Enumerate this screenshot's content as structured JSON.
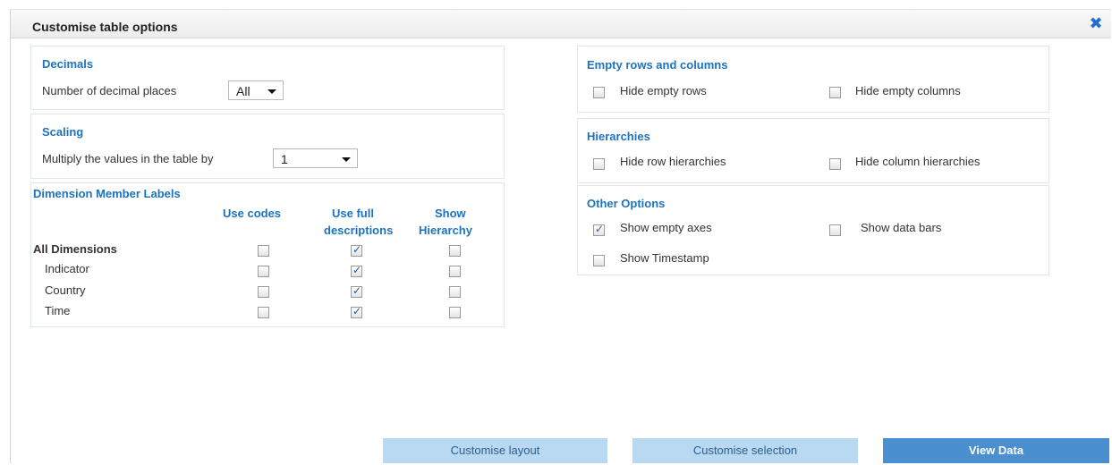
{
  "dialog": {
    "title": "Customise table options"
  },
  "decimals": {
    "title": "Decimals",
    "label": "Number of decimal places",
    "value": "All"
  },
  "scaling": {
    "title": "Scaling",
    "label": "Multiply the values in the table by",
    "value": "1"
  },
  "dimension_labels": {
    "title": "Dimension Member Labels",
    "columns": [
      "Use codes",
      "Use full descriptions",
      "Show Hierarchy"
    ],
    "col1": "Use codes",
    "col2_line1": "Use full",
    "col2_line2": "descriptions",
    "col3_line1": "Show",
    "col3_line2": "Hierarchy",
    "rows": [
      {
        "label": "All Dimensions",
        "use_codes": false,
        "use_full": true,
        "show_hierarchy": false
      },
      {
        "label": "Indicator",
        "use_codes": false,
        "use_full": true,
        "show_hierarchy": false
      },
      {
        "label": "Country",
        "use_codes": false,
        "use_full": true,
        "show_hierarchy": false
      },
      {
        "label": "Time",
        "use_codes": false,
        "use_full": true,
        "show_hierarchy": false
      }
    ]
  },
  "empty": {
    "title": "Empty rows and columns",
    "hide_rows": {
      "label": "Hide empty rows",
      "checked": false
    },
    "hide_cols": {
      "label": "Hide empty columns",
      "checked": false
    }
  },
  "hierarchies": {
    "title": "Hierarchies",
    "hide_row": {
      "label": "Hide row hierarchies",
      "checked": false
    },
    "hide_col": {
      "label": "Hide column hierarchies",
      "checked": false
    }
  },
  "other": {
    "title": "Other Options",
    "show_empty_axes": {
      "label": "Show empty axes",
      "checked": true
    },
    "show_data_bars": {
      "label": "Show data bars",
      "checked": false
    },
    "show_timestamp": {
      "label": "Show Timestamp",
      "checked": false
    }
  },
  "buttons": {
    "customise_layout": "Customise layout",
    "customise_selection": "Customise selection",
    "view_data": "View Data"
  },
  "icons": {
    "close": "close-icon",
    "dropdown": "chevron-down-icon",
    "check": "checkmark-icon"
  },
  "colors": {
    "accent": "#1e73be",
    "button_light": "#b9d8f2",
    "button_dark": "#4a8fd0"
  }
}
